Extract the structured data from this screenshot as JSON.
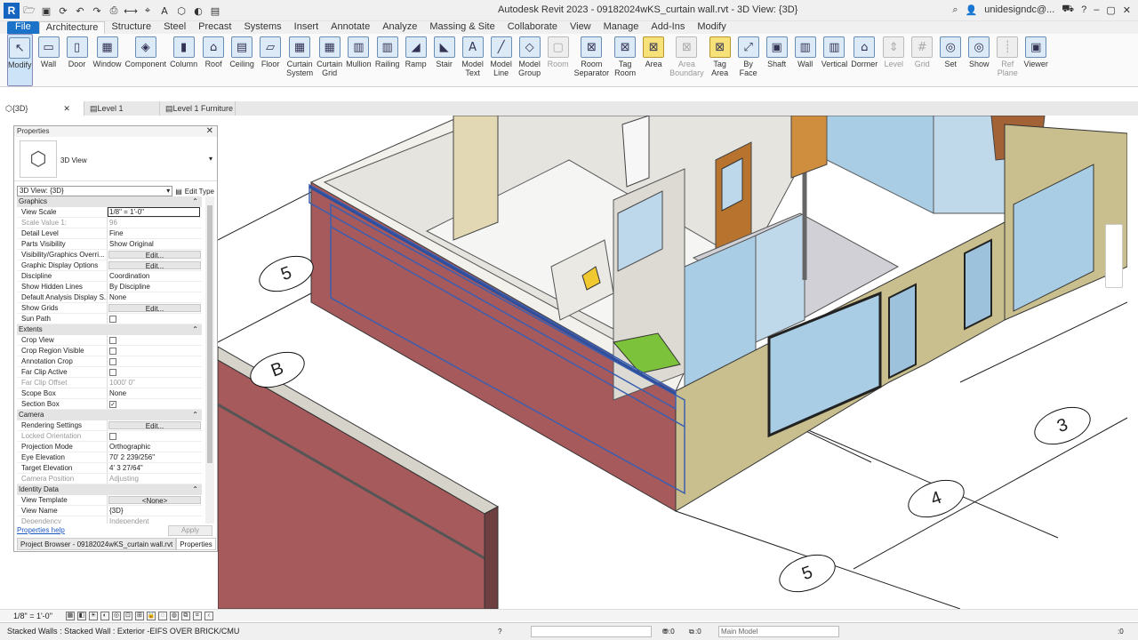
{
  "app": {
    "title": "Autodesk Revit 2023 - 09182024wKS_curtain wall.rvt - 3D View: {3D}",
    "logo": "R",
    "user": "unidesigndc@...",
    "icon_bar": [
      "open-icon",
      "save-icon",
      "sync-icon",
      "undo-icon",
      "redo-icon",
      "print-icon",
      "measure-icon",
      "tag-icon",
      "text-icon",
      "3d-view-icon",
      "section-icon",
      "switch-windows-icon"
    ]
  },
  "ribbon_tabs": [
    "File",
    "Architecture",
    "Structure",
    "Steel",
    "Precast",
    "Systems",
    "Insert",
    "Annotate",
    "Analyze",
    "Massing & Site",
    "Collaborate",
    "View",
    "Manage",
    "Add-Ins",
    "Modify"
  ],
  "active_tab": "Architecture",
  "ribbon_buttons": [
    {
      "label": "Modify",
      "glyph": "↖",
      "style": "sel"
    },
    {
      "label": "Wall",
      "glyph": "▭"
    },
    {
      "label": "Door",
      "glyph": "▯"
    },
    {
      "label": "Window",
      "glyph": "▦"
    },
    {
      "label": "Component",
      "glyph": "◈"
    },
    {
      "label": "Column",
      "glyph": "▮"
    },
    {
      "label": "Roof",
      "glyph": "⌂"
    },
    {
      "label": "Ceiling",
      "glyph": "▤"
    },
    {
      "label": "Floor",
      "glyph": "▱"
    },
    {
      "label": "Curtain\nSystem",
      "glyph": "▦"
    },
    {
      "label": "Curtain\nGrid",
      "glyph": "▦"
    },
    {
      "label": "Mullion",
      "glyph": "▥"
    },
    {
      "label": "Railing",
      "glyph": "▥"
    },
    {
      "label": "Ramp",
      "glyph": "◢"
    },
    {
      "label": "Stair",
      "glyph": "◣"
    },
    {
      "label": "Model\nText",
      "glyph": "A"
    },
    {
      "label": "Model\nLine",
      "glyph": "╱"
    },
    {
      "label": "Model\nGroup",
      "glyph": "◇"
    },
    {
      "label": "Room",
      "glyph": "▢",
      "style": "g"
    },
    {
      "label": "Room\nSeparator",
      "glyph": "⊠"
    },
    {
      "label": "Tag\nRoom",
      "glyph": "⊠"
    },
    {
      "label": "Area",
      "glyph": "⊠",
      "style": "y"
    },
    {
      "label": "Area\nBoundary",
      "glyph": "⊠",
      "style": "g"
    },
    {
      "label": "Tag\nArea",
      "glyph": "⊠",
      "style": "y"
    },
    {
      "label": "By\nFace",
      "glyph": "⤢"
    },
    {
      "label": "Shaft",
      "glyph": "▣"
    },
    {
      "label": "Wall",
      "glyph": "▥"
    },
    {
      "label": "Vertical",
      "glyph": "▥"
    },
    {
      "label": "Dormer",
      "glyph": "⌂"
    },
    {
      "label": "Level",
      "glyph": "⇕",
      "style": "g"
    },
    {
      "label": "Grid",
      "glyph": "#",
      "style": "g"
    },
    {
      "label": "Set",
      "glyph": "◎"
    },
    {
      "label": "Show",
      "glyph": "◎"
    },
    {
      "label": "Ref\nPlane",
      "glyph": "┊",
      "style": "g"
    },
    {
      "label": "Viewer",
      "glyph": "▣"
    }
  ],
  "view_tabs": [
    {
      "label": "{3D}",
      "active": true
    },
    {
      "label": "Level 1"
    },
    {
      "label": "Level 1 Furniture"
    }
  ],
  "properties": {
    "title": "Properties",
    "type_name": "3D View",
    "instance": "3D View: {3D}",
    "edit_type": "Edit Type",
    "sections": [
      {
        "name": "Graphics",
        "rows": [
          {
            "k": "View Scale",
            "v": "1/8\" = 1'-0\"",
            "t": "field"
          },
          {
            "k": "Scale Value    1:",
            "v": "96",
            "dim": true
          },
          {
            "k": "Detail Level",
            "v": "Fine"
          },
          {
            "k": "Parts Visibility",
            "v": "Show Original"
          },
          {
            "k": "Visibility/Graphics Overri...",
            "v": "Edit...",
            "t": "btn"
          },
          {
            "k": "Graphic Display Options",
            "v": "Edit...",
            "t": "btn"
          },
          {
            "k": "Discipline",
            "v": "Coordination"
          },
          {
            "k": "Show Hidden Lines",
            "v": "By Discipline"
          },
          {
            "k": "Default Analysis Display S...",
            "v": "None"
          },
          {
            "k": "Show Grids",
            "v": "Edit...",
            "t": "btn"
          },
          {
            "k": "Sun Path",
            "v": "",
            "t": "chk"
          }
        ]
      },
      {
        "name": "Extents",
        "rows": [
          {
            "k": "Crop View",
            "v": "",
            "t": "chk"
          },
          {
            "k": "Crop Region Visible",
            "v": "",
            "t": "chk"
          },
          {
            "k": "Annotation Crop",
            "v": "",
            "t": "chk"
          },
          {
            "k": "Far Clip Active",
            "v": "",
            "t": "chk"
          },
          {
            "k": "Far Clip Offset",
            "v": "1000'  0\"",
            "dim": true
          },
          {
            "k": "Scope Box",
            "v": "None"
          },
          {
            "k": "Section Box",
            "v": "✓",
            "t": "chk"
          }
        ]
      },
      {
        "name": "Camera",
        "rows": [
          {
            "k": "Rendering Settings",
            "v": "Edit...",
            "t": "btn"
          },
          {
            "k": "Locked Orientation",
            "v": "",
            "t": "chk",
            "dim": true
          },
          {
            "k": "Projection Mode",
            "v": "Orthographic"
          },
          {
            "k": "Eye Elevation",
            "v": "70'  2 239/256\""
          },
          {
            "k": "Target Elevation",
            "v": "4'  3 27/64\""
          },
          {
            "k": "Camera Position",
            "v": "Adjusting",
            "dim": true
          }
        ]
      },
      {
        "name": "Identity Data",
        "rows": [
          {
            "k": "View Template",
            "v": "<None>",
            "t": "btn"
          },
          {
            "k": "View Name",
            "v": "{3D}"
          },
          {
            "k": "Dependency",
            "v": "Independent",
            "dim": true
          }
        ]
      }
    ],
    "help": "Properties help",
    "apply": "Apply",
    "bottom_tabs": [
      "Project Browser - 09182024wKS_curtain wall.rvt",
      "Properties"
    ]
  },
  "grid_bubbles": [
    "5",
    "B",
    "3",
    "4",
    "5"
  ],
  "view_control": {
    "scale": "1/8\" = 1'-0\""
  },
  "status": {
    "message": "Stacked Walls : Stacked Wall : Exterior -EIFS OVER BRICK/CMU",
    "selection_count": ":0",
    "design_options_count": ":0",
    "model": "Main Model",
    "filter_count": ":0"
  },
  "colors": {
    "accent": "#1a73c8",
    "brick": "#a75a5c",
    "stucco": "#c9bf8e",
    "glass": "#a9cde4",
    "selection": "#3a5fb0"
  }
}
